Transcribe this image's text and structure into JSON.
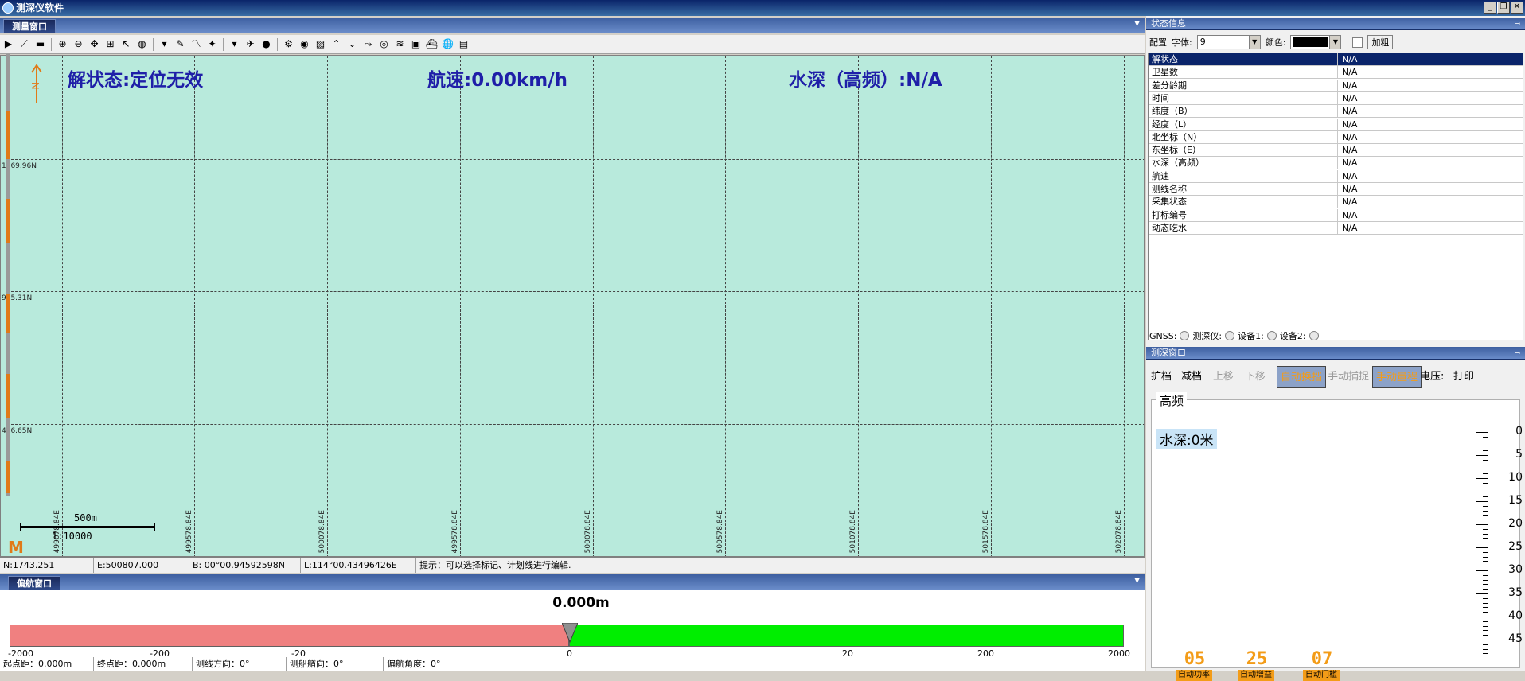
{
  "window": {
    "title": "测深仪软件"
  },
  "survey_pane": {
    "tab": "测量窗口",
    "overlay": {
      "status": "解状态:定位无效",
      "speed": "航速:0.00km/h",
      "depth": "水深（高频）:N/A"
    },
    "north_label": "N",
    "y_labels": [
      "1469.96N",
      "965.31N",
      "466.65N"
    ],
    "x_labels": [
      "499078.84E",
      "499578.84E",
      "500078.84E",
      "499578.84E",
      "500078.84E",
      "500578.84E",
      "501078.84E",
      "501578.84E",
      "502078.84E"
    ],
    "scale_bar": {
      "label": "500m",
      "ratio": "1:10000"
    },
    "status_bar": {
      "n": "N:1743.251",
      "e": "E:500807.000",
      "b": "B: 00°00.94592598N",
      "l": "L:114°00.43496426E",
      "hint": "提示：可以选择标记、计划线进行编辑."
    },
    "toolbar_icons": [
      "play-icon",
      "line-icon",
      "vehicle-icon",
      "zoom-in-icon",
      "zoom-out-icon",
      "pan-icon",
      "zoom-window-icon",
      "select-icon",
      "globe-icon",
      "dropdown-icon",
      "pin-icon",
      "measure-icon",
      "waypoint-icon",
      "dropdown-icon",
      "plane-icon",
      "circle-icon",
      "settings-icon",
      "eye-icon",
      "hatch-icon",
      "chevron-up-icon",
      "chevron-down-icon",
      "route-icon",
      "target-icon",
      "layers-icon",
      "image-icon",
      "ship-icon",
      "world-icon",
      "report-icon"
    ]
  },
  "deviation_pane": {
    "tab": "偏航窗口",
    "value": "0.000m",
    "ticks": [
      "-2000",
      "-200",
      "-20",
      "0",
      "20",
      "200",
      "2000"
    ],
    "footer": {
      "start": "起点距：0.000m",
      "end": "终点距：0.000m",
      "line_dir": "测线方向：0°",
      "ship_dir": "测船艏向：0°",
      "yaw": "偏航角度：0°"
    },
    "colors": {
      "negative": "#f08080",
      "positive": "#00ee00"
    }
  },
  "status_info": {
    "title": "状态信息",
    "config_label": "配置",
    "font_label": "字体:",
    "font_value": "9",
    "color_label": "颜色:",
    "bold_label": "加粗",
    "rows": [
      {
        "k": "解状态",
        "v": "N/A"
      },
      {
        "k": "卫星数",
        "v": "N/A"
      },
      {
        "k": "差分龄期",
        "v": "N/A"
      },
      {
        "k": "时间",
        "v": "N/A"
      },
      {
        "k": "纬度（B）",
        "v": "N/A"
      },
      {
        "k": "经度（L）",
        "v": "N/A"
      },
      {
        "k": "北坐标（N）",
        "v": "N/A"
      },
      {
        "k": "东坐标（E）",
        "v": "N/A"
      },
      {
        "k": "水深（高频）",
        "v": "N/A"
      },
      {
        "k": "航速",
        "v": "N/A"
      },
      {
        "k": "测线名称",
        "v": "N/A"
      },
      {
        "k": "采集状态",
        "v": "N/A"
      },
      {
        "k": "打标编号",
        "v": "N/A"
      },
      {
        "k": "动态吃水",
        "v": "N/A"
      }
    ],
    "gnss": {
      "gnss": "GNSS:",
      "sounder": "测深仪:",
      "dev1": "设备1:",
      "dev2": "设备2:"
    }
  },
  "sounder_pane": {
    "title": "测深窗口",
    "buttons": [
      {
        "label": "扩档",
        "state": "normal"
      },
      {
        "label": "减档",
        "state": "normal"
      },
      {
        "label": "上移",
        "state": "disabled"
      },
      {
        "label": "下移",
        "state": "disabled"
      },
      {
        "label": "自动换挡",
        "state": "active"
      },
      {
        "label": "手动捕捉",
        "state": "disabled"
      },
      {
        "label": "手动量程",
        "state": "active"
      },
      {
        "label": "电压:",
        "state": "normal"
      },
      {
        "label": "打印",
        "state": "normal"
      }
    ],
    "group_label": "高频",
    "depth_text": "水深:0米",
    "axis": [
      "0",
      "5",
      "10",
      "15",
      "20",
      "25",
      "30",
      "35",
      "40",
      "45"
    ],
    "leds": [
      {
        "value": "05",
        "label": "自动功率"
      },
      {
        "value": "25",
        "label": "自动增益"
      },
      {
        "value": "07",
        "label": "自动门槛"
      }
    ]
  }
}
